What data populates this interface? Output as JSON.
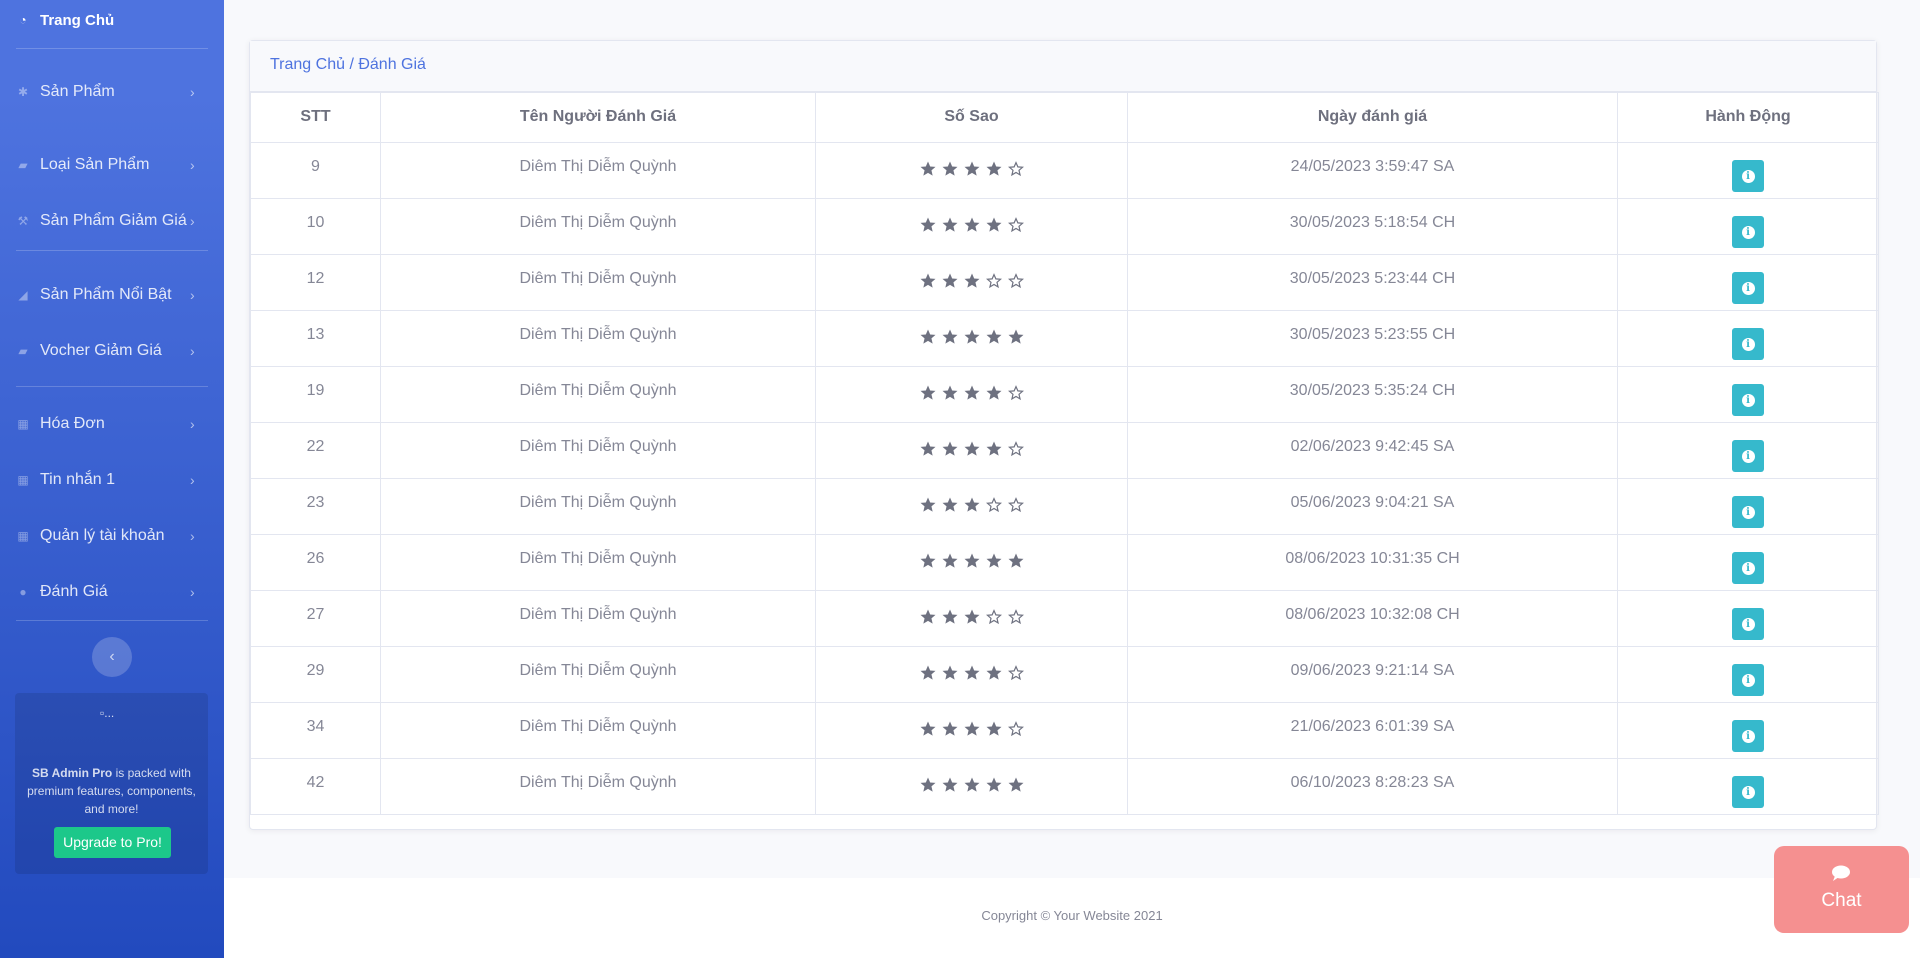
{
  "sidebar": {
    "home": "Trang Chủ",
    "items": [
      {
        "label": "Sản Phẩm",
        "icon": "gear-icon"
      },
      {
        "label": "Loại Sản Phẩm",
        "icon": "folder-icon"
      },
      {
        "label": "Sản Phẩm Giảm Giá",
        "icon": "wrench-icon"
      },
      {
        "label": "Sản Phẩm Nổi Bật",
        "icon": "chart-area-icon"
      },
      {
        "label": "Vocher Giảm Giá",
        "icon": "folder-icon"
      },
      {
        "label": "Hóa Đơn",
        "icon": "table-icon"
      },
      {
        "label": "Tin nhắn 1",
        "icon": "table-icon"
      },
      {
        "label": "Quản lý tài khoản",
        "icon": "table-icon"
      },
      {
        "label": "Đánh Giá",
        "icon": "comment-icon"
      }
    ],
    "promo": {
      "image_alt": "...",
      "brand": "SB Admin Pro",
      "text": " is packed with premium features, components, and more!",
      "button": "Upgrade to Pro!"
    }
  },
  "breadcrumb": "Trang Chủ / Đánh Giá",
  "table": {
    "headers": [
      "STT",
      "Tên Người Đánh Giá",
      "Số Sao",
      "Ngày đánh giá",
      "Hành Động"
    ],
    "rows": [
      {
        "stt": "9",
        "name": "Diêm Thị Diễm Quỳnh",
        "stars": 4,
        "date": "24/05/2023 3:59:47 SA"
      },
      {
        "stt": "10",
        "name": "Diêm Thị Diễm Quỳnh",
        "stars": 4,
        "date": "30/05/2023 5:18:54 CH"
      },
      {
        "stt": "12",
        "name": "Diêm Thị Diễm Quỳnh",
        "stars": 3,
        "date": "30/05/2023 5:23:44 CH"
      },
      {
        "stt": "13",
        "name": "Diêm Thị Diễm Quỳnh",
        "stars": 5,
        "date": "30/05/2023 5:23:55 CH"
      },
      {
        "stt": "19",
        "name": "Diêm Thị Diễm Quỳnh",
        "stars": 4,
        "date": "30/05/2023 5:35:24 CH"
      },
      {
        "stt": "22",
        "name": "Diêm Thị Diễm Quỳnh",
        "stars": 4,
        "date": "02/06/2023 9:42:45 SA"
      },
      {
        "stt": "23",
        "name": "Diêm Thị Diễm Quỳnh",
        "stars": 3,
        "date": "05/06/2023 9:04:21 SA"
      },
      {
        "stt": "26",
        "name": "Diêm Thị Diễm Quỳnh",
        "stars": 5,
        "date": "08/06/2023 10:31:35 CH"
      },
      {
        "stt": "27",
        "name": "Diêm Thị Diễm Quỳnh",
        "stars": 3,
        "date": "08/06/2023 10:32:08 CH"
      },
      {
        "stt": "29",
        "name": "Diêm Thị Diễm Quỳnh",
        "stars": 4,
        "date": "09/06/2023 9:21:14 SA"
      },
      {
        "stt": "34",
        "name": "Diêm Thị Diễm Quỳnh",
        "stars": 4,
        "date": "21/06/2023 6:01:39 SA"
      },
      {
        "stt": "42",
        "name": "Diêm Thị Diễm Quỳnh",
        "stars": 5,
        "date": "06/10/2023 8:28:23 SA"
      }
    ],
    "max_stars": 5,
    "action_icon": "info-icon"
  },
  "footer": {
    "copyright": "Copyright © Your Website 2021"
  },
  "chat": {
    "label": "Chat",
    "icon": "comment-icon"
  },
  "colors": {
    "sidebar_top": "#4e73df",
    "sidebar_bottom": "#224abe",
    "primary": "#4e73df",
    "info": "#36b9cc",
    "success": "#1cc88a",
    "star": "#6e7180",
    "chat": "#f59090"
  }
}
